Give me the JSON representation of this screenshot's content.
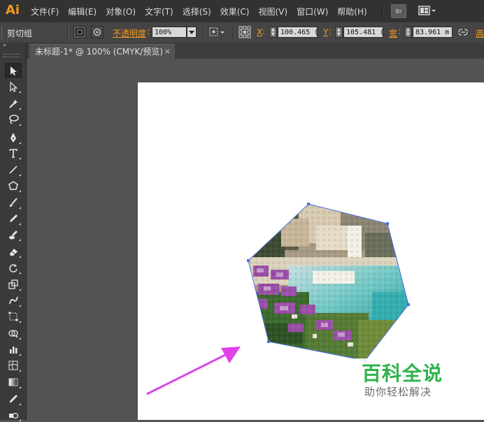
{
  "app": {
    "logo": "Ai"
  },
  "menu": {
    "items": [
      "文件(F)",
      "编辑(E)",
      "对象(O)",
      "文字(T)",
      "选择(S)",
      "效果(C)",
      "视图(V)",
      "窗口(W)",
      "帮助(H)"
    ],
    "bridge_label": "Br"
  },
  "control_bar": {
    "selection_type": "剪切组",
    "opacity_label": "不透明度",
    "opacity_value": "100%",
    "x_label": "X",
    "x_value": "100.465 (",
    "y_label": "Y",
    "y_value": "105.481 (",
    "width_label": "宽",
    "width_value": "83.961 m",
    "height_label": "高"
  },
  "document_tab": {
    "title": "未标题-1* @ 100% (CMYK/预览)",
    "close": "×"
  },
  "tools": [
    "selection-tool-icon",
    "direct-selection-tool-icon",
    "magic-wand-tool-icon",
    "lasso-tool-icon",
    "pen-tool-icon",
    "type-tool-icon",
    "line-segment-tool-icon",
    "shape-tool-icon",
    "paintbrush-tool-icon",
    "pencil-tool-icon",
    "blob-brush-tool-icon",
    "eraser-tool-icon",
    "rotate-tool-icon",
    "scale-tool-icon",
    "warp-tool-icon",
    "free-transform-tool-icon",
    "shape-builder-tool-icon",
    "graph-tool-icon",
    "mesh-tool-icon",
    "gradient-tool-icon",
    "eyedropper-tool-icon",
    "blend-tool-icon"
  ],
  "colors": {
    "accent_orange": "#f39a1e",
    "selection_blue": "#4a6ee0",
    "arrow_magenta": "#e040e8",
    "watermark_green": "#2eb34a"
  },
  "watermark": {
    "title": "百科全说",
    "subtitle": "助你轻松解决"
  }
}
